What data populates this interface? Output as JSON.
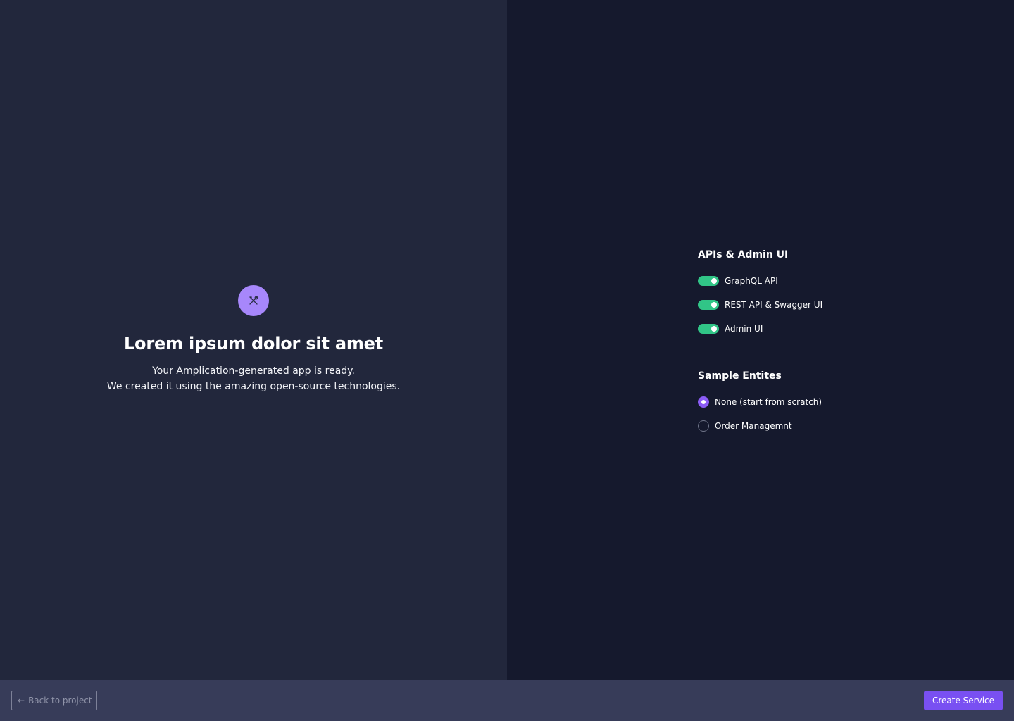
{
  "hero": {
    "icon": "tools-icon",
    "title": "Lorem ipsum dolor sit amet",
    "line1": "Your Amplication-generated app is ready.",
    "line2": "We created it using the amazing open-source technologies."
  },
  "apis": {
    "title": "APIs & Admin UI",
    "toggles": [
      {
        "label": "GraphQL API",
        "on": true
      },
      {
        "label": "REST API & Swagger UI",
        "on": true
      },
      {
        "label": "Admin UI",
        "on": true
      }
    ]
  },
  "entities": {
    "title": "Sample Entites",
    "options": [
      {
        "label": "None (start from scratch)",
        "selected": true
      },
      {
        "label": "Order Managemnt",
        "selected": false
      }
    ]
  },
  "footer": {
    "back_label": "Back to project",
    "create_label": "Create Service"
  },
  "colors": {
    "accent": "#7950f2",
    "toggle_on": "#31c587",
    "icon_bg": "#a787fb"
  }
}
